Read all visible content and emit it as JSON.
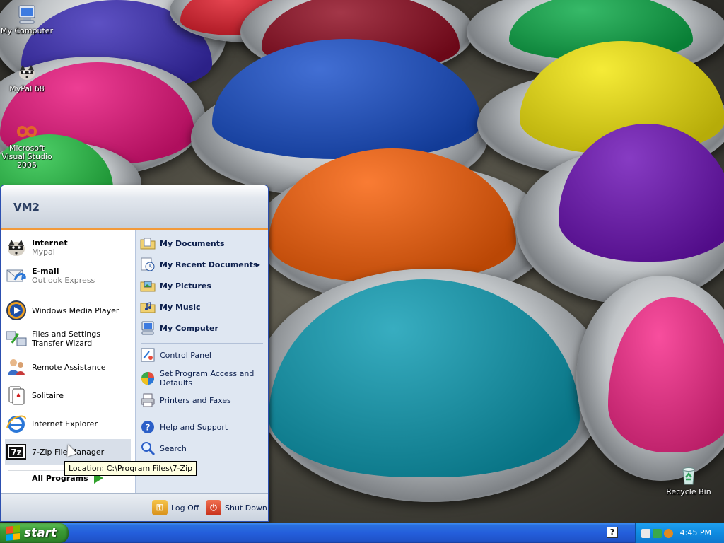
{
  "desktop": {
    "icons": [
      {
        "label": "My Computer",
        "icon": "my-computer-icon"
      },
      {
        "label": "MyPal 68",
        "icon": "mypal-icon"
      },
      {
        "label": "Microsoft Visual Studio 2005",
        "icon": "visual-studio-icon"
      },
      {
        "label": "Recycle Bin",
        "icon": "recycle-bin-icon"
      }
    ]
  },
  "start_menu": {
    "user_name": "VM2",
    "pinned": [
      {
        "title": "Internet",
        "subtitle": "Mypal",
        "icon": "mypal-icon"
      },
      {
        "title": "E-mail",
        "subtitle": "Outlook Express",
        "icon": "outlook-express-icon"
      }
    ],
    "recent": [
      {
        "label": "Windows Media Player",
        "icon": "media-player-icon"
      },
      {
        "label": "Files and Settings Transfer Wizard",
        "icon": "transfer-wizard-icon"
      },
      {
        "label": "Remote Assistance",
        "icon": "remote-assistance-icon"
      },
      {
        "label": "Solitaire",
        "icon": "solitaire-icon"
      },
      {
        "label": "Internet Explorer",
        "icon": "internet-explorer-icon"
      },
      {
        "label": "7-Zip File Manager",
        "icon": "seven-zip-icon"
      }
    ],
    "all_programs": "All Programs",
    "places": [
      {
        "label": "My Documents",
        "icon": "folder-documents-icon"
      },
      {
        "label": "My Recent Documents",
        "icon": "recent-documents-icon"
      },
      {
        "label": "My Pictures",
        "icon": "folder-pictures-icon"
      },
      {
        "label": "My Music",
        "icon": "folder-music-icon"
      },
      {
        "label": "My Computer",
        "icon": "my-computer-icon"
      }
    ],
    "system": [
      {
        "label": "Control Panel",
        "icon": "control-panel-icon"
      },
      {
        "label": "Set Program Access and Defaults",
        "icon": "program-defaults-icon"
      },
      {
        "label": "Printers and Faxes",
        "icon": "printer-icon"
      }
    ],
    "support": [
      {
        "label": "Help and Support",
        "icon": "help-icon"
      },
      {
        "label": "Search",
        "icon": "search-icon"
      }
    ],
    "log_off": "Log Off",
    "shut_down": "Shut Down"
  },
  "tooltip": "Location: C:\\Program Files\\7-Zip",
  "taskbar": {
    "start_label": "start",
    "clock": "4:45 PM"
  },
  "colors": {
    "taskbar_blue": "#245edb",
    "start_green": "#3a9a35",
    "menu_accent_orange": "#f39a3a",
    "places_panel": "#dfe7f2"
  }
}
